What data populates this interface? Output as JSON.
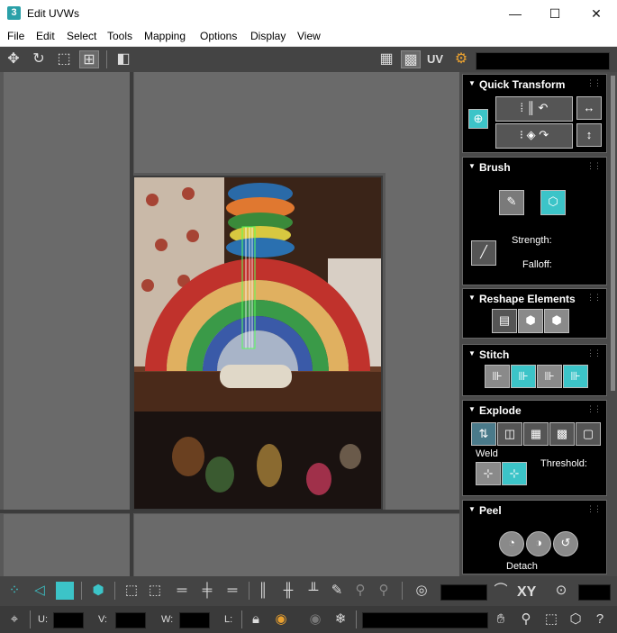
{
  "window": {
    "app_icon_text": "3",
    "title": "Edit UVWs",
    "minimize_glyph": "—",
    "maximize_glyph": "☐",
    "close_glyph": "✕"
  },
  "menu": [
    "File",
    "Edit",
    "Select",
    "Tools",
    "Mapping",
    "Options",
    "Display",
    "View"
  ],
  "toolbar": {
    "uv_label": "UV",
    "texture_dropdown_value": "",
    "icons": [
      "move-icon",
      "rotate-icon",
      "scale-icon",
      "freeform-icon",
      "mirror-icon",
      "checker-icon",
      "checker-selected-icon",
      "uv-icon",
      "settings-texture-icon"
    ]
  },
  "rollouts": {
    "quick_transform": {
      "title": "Quick Transform"
    },
    "brush": {
      "title": "Brush",
      "strength_label": "Strength:",
      "falloff_label": "Falloff:"
    },
    "reshape": {
      "title": "Reshape Elements"
    },
    "stitch": {
      "title": "Stitch"
    },
    "explode": {
      "title": "Explode",
      "weld_label": "Weld",
      "threshold_label": "Threshold:"
    },
    "peel": {
      "title": "Peel",
      "detach_label": "Detach"
    }
  },
  "bottom": {
    "xy_label": "XY",
    "u_label": "U:",
    "v_label": "V:",
    "w_label": "W:",
    "l_label": "L:",
    "u_value": "",
    "v_value": "",
    "w_value": "",
    "l_value": ""
  },
  "colors": {
    "accent_teal": "#3cc4c8",
    "panel_black": "#000000",
    "viewport_grey": "#585858"
  }
}
